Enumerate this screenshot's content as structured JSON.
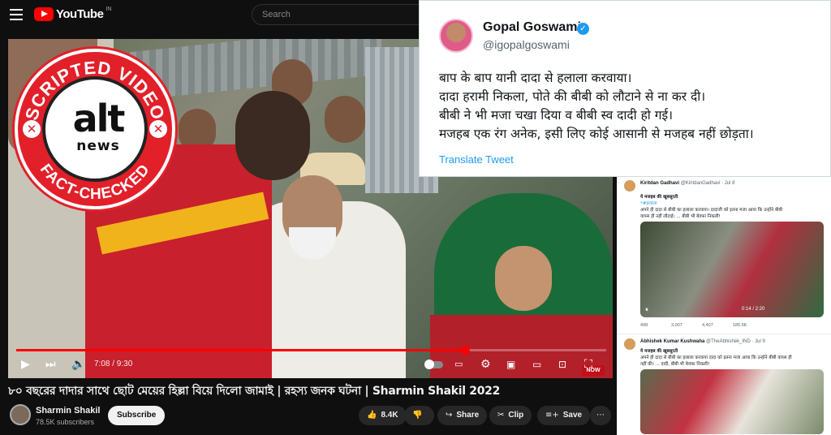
{
  "youtube": {
    "brand": "YouTube",
    "region": "IN",
    "search_placeholder": "Search",
    "player": {
      "time": "7:08 / 9:30",
      "progress": 0.76,
      "now_badge": "NOW"
    },
    "video_title": "৮০ বছরের দাদার সাথে ছোট মেয়ের হিল্লা বিয়ে দিলো জামাই | রহস্য জনক ঘটনা | Sharmin Shakil 2022",
    "channel_name": "Sharmin Shakil",
    "subscribers": "78.5K subscribers",
    "subscribe_label": "Subscribe",
    "likes": "8.4K",
    "share_label": "Share",
    "clip_label": "Clip",
    "save_label": "Save"
  },
  "stamp": {
    "top_text": "SCRIPTED VIDEO",
    "logo_text": "alt",
    "logo_sub": "news",
    "bottom_text": "FACT-CHECKED",
    "color": "#e2202a"
  },
  "tweet": {
    "name": "Gopal Goswami",
    "handle": "@igopalgoswami",
    "lines": [
      "बाप के बाप यानी दादा से हलाला करवाया।",
      "दादा हरामी निकला, पोते की बीबी को लौटाने से ना कर दी।",
      "बीबी ने भी मजा चखा दिया व बीबी स्व दादी हो गई।",
      "मजहब एक रंग अनेक, इसी लिए कोई आसानी से मजहब नहीं छोड़ता।"
    ],
    "translate_label": "Translate Tweet"
  },
  "side_tweets": [
    {
      "name": "Kiritdan Gadhavi",
      "meta": "@KiritdanGadhavi · Jul 8",
      "lines": [
        "ये मजहब की खूबसूरती",
        "*#हलाला",
        "अपने ही दादा से बीबी का हलाला करवाया। दादाजी को इतना मजा आया कि उन्होंने बीबी",
        "वापस ही नहीं लौटाई। ... बीबी भी बेवफा निकली!"
      ],
      "video_time": "0:14 / 2:20",
      "stats": [
        "498",
        "3,007",
        "4,407",
        "185.6K"
      ]
    },
    {
      "name": "Abhishek Kumar Kushwaha",
      "meta": "@TheAbhishek_IND · Jul 9",
      "lines": [
        "ये मजहब की खूबसूरती",
        "अपने ही दादा से बीबी का हलाला करवाया दादा को इतना मजा आया कि उन्होंने बीबी वापस ही",
        "नहीं की। ... दादी, बीबी भी बेवफा निकली!"
      ]
    }
  ]
}
